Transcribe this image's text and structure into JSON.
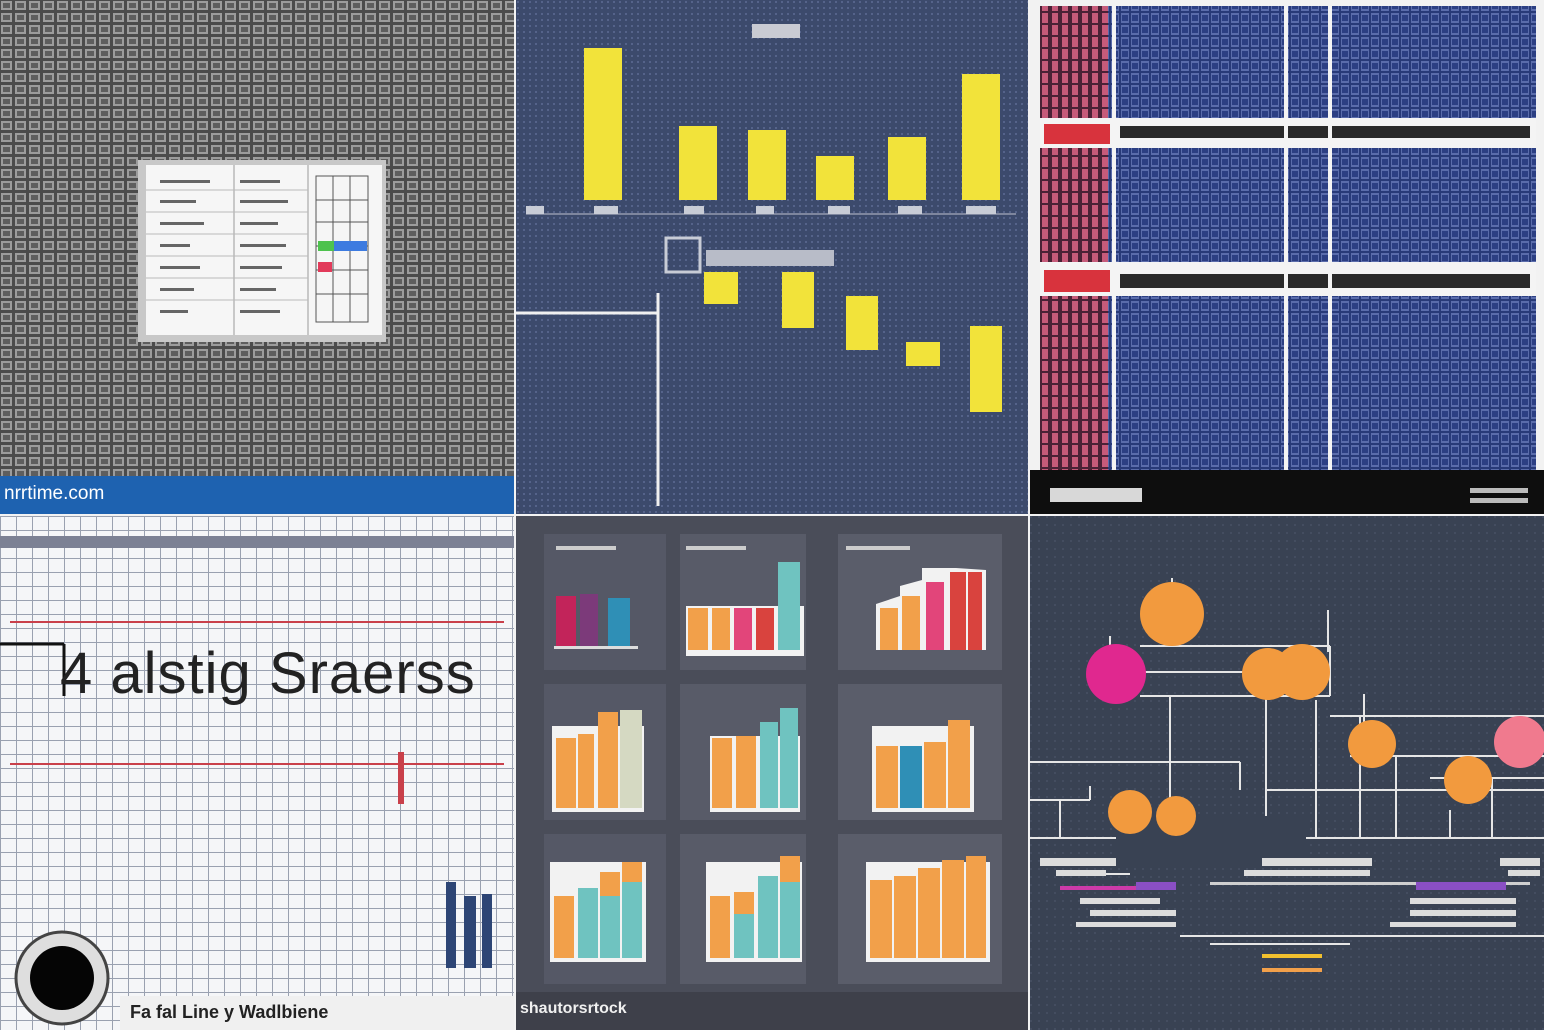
{
  "tiles": {
    "t1": {
      "footer_text": "nrrtime.com"
    },
    "t4": {
      "headline": "4 alstig Sraerss",
      "footer_text": "Fa fal Line y Wadlbiene"
    },
    "t5": {
      "footer_text": "shautorsrtock"
    }
  },
  "colors": {
    "yellow": "#f2e33a",
    "orange": "#f2a04a",
    "teal": "#6fc3c0",
    "pink": "#e2457a",
    "red": "#d9433e",
    "magenta": "#e21a8d",
    "navy": "#283a78",
    "footer_blue": "#1e62b0"
  }
}
